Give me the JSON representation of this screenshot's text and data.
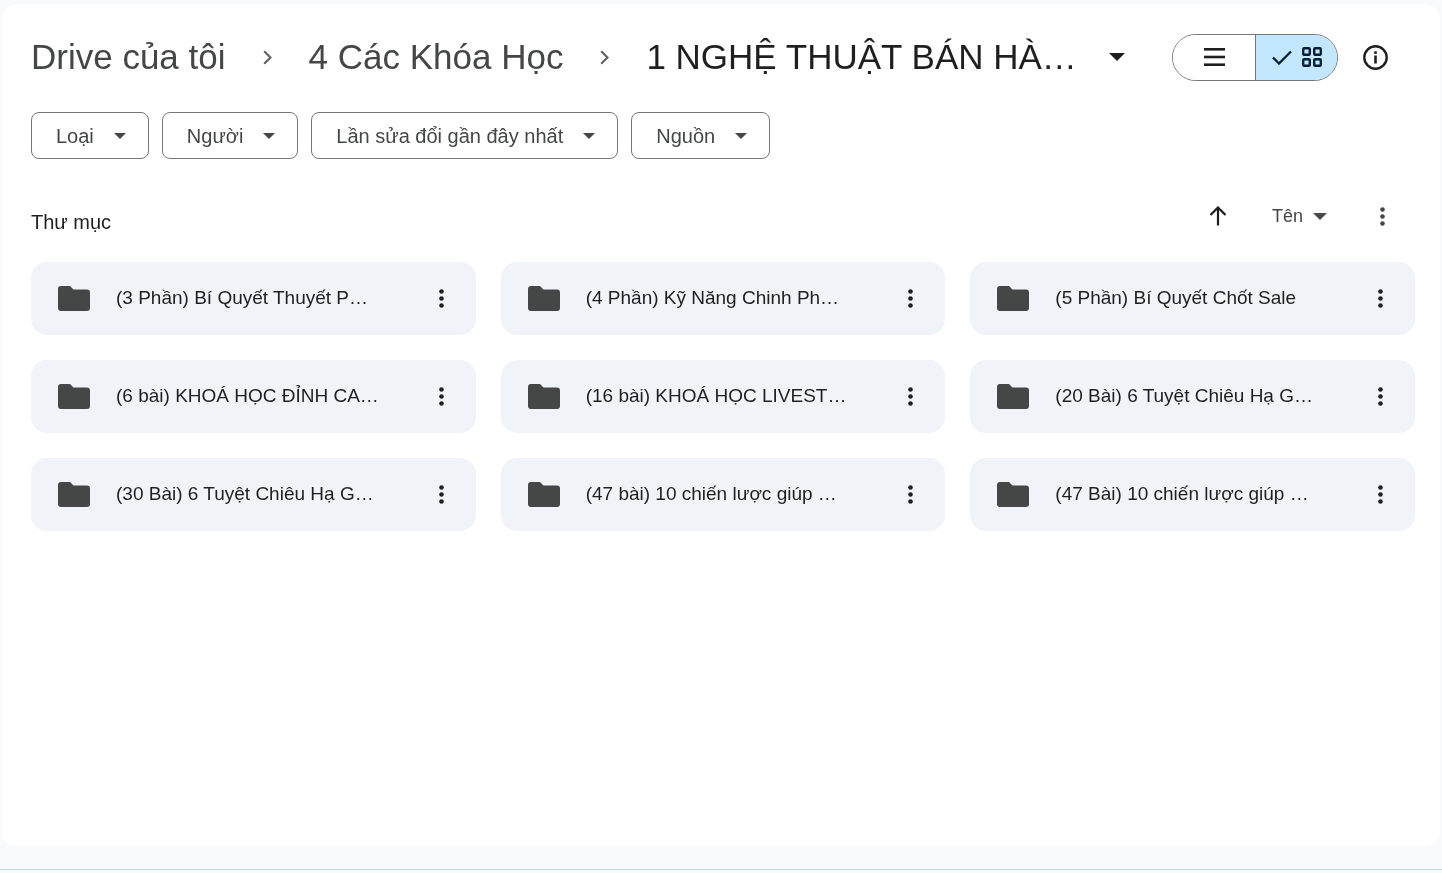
{
  "breadcrumb": [
    "Drive của tôi",
    "4 Các Khóa Học",
    "1 NGHỆ THUẬT BÁN HÀ…"
  ],
  "view_toggle": [
    {
      "kind": "list",
      "selected": false
    },
    {
      "kind": "grid",
      "selected": true
    }
  ],
  "filters": [
    "Loại",
    "Người",
    "Lần sửa đổi gần đây nhất",
    "Nguồn"
  ],
  "section": {
    "title": "Thư mục",
    "sort_label": "Tên"
  },
  "folders": [
    "(3 Phần) Bí Quyết Thuyết P…",
    "(4 Phần) Kỹ Năng Chinh Ph…",
    "(5 Phần) Bí Quyết Chốt Sale",
    "(6 bài) KHOÁ HỌC ĐỈNH CA…",
    "(16 bài) KHOÁ HỌC LIVEST…",
    "(20 Bài) 6 Tuyệt Chiêu Hạ G…",
    "(30 Bài) 6 Tuyệt Chiêu Hạ G…",
    "(47 bài) 10 chiến lược giúp …",
    "(47 Bài) 10 chiến lược giúp …"
  ]
}
